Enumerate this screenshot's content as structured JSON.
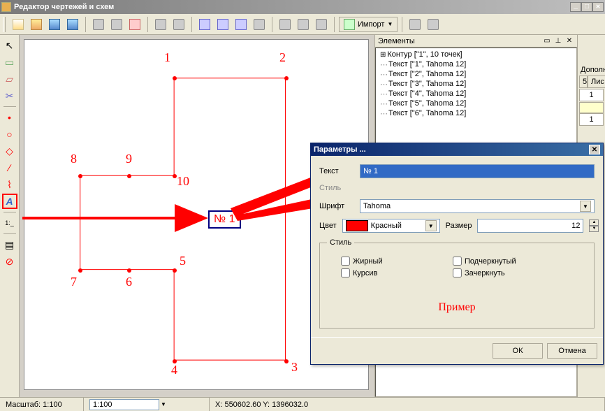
{
  "window": {
    "title": "Редактор чертежей и схем"
  },
  "toolbar": {
    "import": "Импорт"
  },
  "elements_panel": {
    "title": "Элементы",
    "items": [
      "Контур [\"1\", 10 точек]",
      "Текст [\"1\", Tahoma 12]",
      "Текст [\"2\", Tahoma 12]",
      "Текст [\"3\", Tahoma 12]",
      "Текст [\"4\", Tahoma 12]",
      "Текст [\"5\", Tahoma 12]",
      "Текст [\"6\", Tahoma 12]"
    ]
  },
  "far_right": {
    "header1": "Дополни",
    "col5": "5",
    "col_list": "Лис",
    "val1": "1",
    "val2": "1"
  },
  "canvas": {
    "point_labels": [
      "1",
      "2",
      "3",
      "4",
      "5",
      "6",
      "7",
      "8",
      "9",
      "10"
    ],
    "text_box": "№ 1"
  },
  "dialog": {
    "title": "Параметры ...",
    "text_label": "Текст",
    "text_value": "№ 1",
    "style_label": "Стиль",
    "font_label": "Шрифт",
    "font_value": "Tahoma",
    "color_label": "Цвет",
    "color_value": "Красный",
    "size_label": "Размер",
    "size_value": "12",
    "style_group": "Стиль",
    "chk_bold": "Жирный",
    "chk_underline": "Подчеркнутый",
    "chk_italic": "Курсив",
    "chk_strike": "Зачеркнуть",
    "preview": "Пример",
    "ok": "ОК",
    "cancel": "Отмена"
  },
  "statusbar": {
    "scale_label": "Масштаб: 1:100",
    "scale_input": "1:100",
    "coords": "X: 550602.60 Y: 1396032.0"
  }
}
